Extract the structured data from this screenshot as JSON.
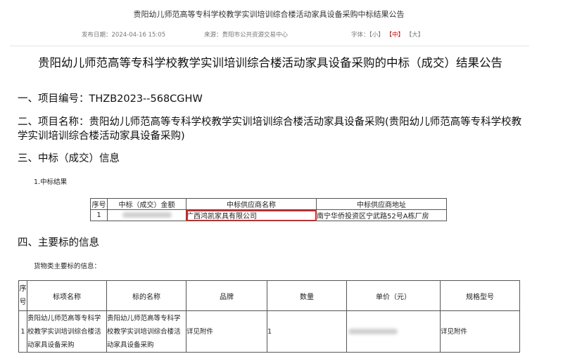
{
  "header": {
    "title": "贵阳幼儿师范高等专科学校教学实训培训综合楼活动家具设备采购中标结果公告",
    "publish_label": "发布日期：",
    "publish_date": "2024-04-16 15:05",
    "source_label": "来源：",
    "source": "贵阳市公共资源交易中心",
    "font_label": "字体：",
    "font_small": "【小】",
    "font_medium": "【中】",
    "font_large": "【大】"
  },
  "doc": {
    "title": "贵阳幼儿师范高等专科学校教学实训培训综合楼活动家具设备采购的中标（成交）结果公告",
    "s1": "一、项目编号：THZB2023--568CGHW",
    "s2": "二、项目名称：贵阳幼儿师范高等专科学校教学实训培训综合楼活动家具设备采购(贵阳幼儿师范高等专科学校教学实训培训综合楼活动家具设备采购)",
    "s3": "三、中标（成交）信息",
    "s3_sub": "1.中标结果",
    "s4": "四、主要标的信息",
    "s4_sub": "货物类主要标的信息："
  },
  "result_table": {
    "headers": [
      "序号",
      "中标（成交）金额",
      "中标供应商名称",
      "中标供应商地址"
    ],
    "row": {
      "index": "1",
      "supplier": "广西鸿凯家具有限公司",
      "address": "南宁华侨投资区宁武路52号A栋厂房"
    }
  },
  "goods_table": {
    "headers": [
      "序号",
      "标项名称",
      "标的名称",
      "品牌",
      "数量",
      "单价（元）",
      "规格型号"
    ],
    "row": {
      "index": "1",
      "lot_name": "贵阳幼儿师范高等专科学校教学实训培训综合楼活动家具设备采购",
      "item_name": "贵阳幼儿师范高等专科学校教学实训培训综合楼活动家具设备采购",
      "brand": "详见附件",
      "quantity": "1",
      "spec": "详见附件"
    }
  }
}
